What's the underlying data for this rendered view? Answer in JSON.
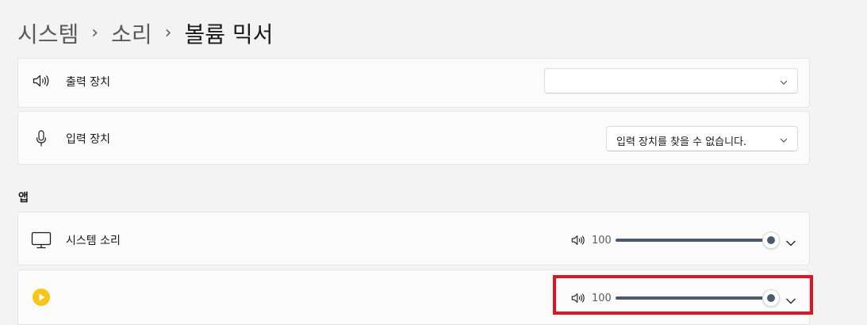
{
  "breadcrumb": {
    "items": [
      "시스템",
      "소리",
      "볼륨 믹서"
    ],
    "separator": "›"
  },
  "output_device": {
    "label": "출력 장치",
    "value": "",
    "icon": "speaker-icon"
  },
  "input_device": {
    "label": "입력 장치",
    "value": "입력 장치를 찾을 수 없습니다.",
    "icon": "microphone-icon"
  },
  "apps_section": {
    "title": "앱"
  },
  "apps": [
    {
      "name": "시스템 소리",
      "icon": "monitor-icon",
      "volume": 100,
      "volume_text": "100"
    },
    {
      "name": "",
      "icon": "media-player-icon",
      "volume": 100,
      "volume_text": "100"
    }
  ],
  "colors": {
    "background": "#f3f3f3",
    "card": "#fbfbfb",
    "slider": "#4c5b6b",
    "highlight": "#e0151f",
    "app_icon": "#f5c518"
  }
}
